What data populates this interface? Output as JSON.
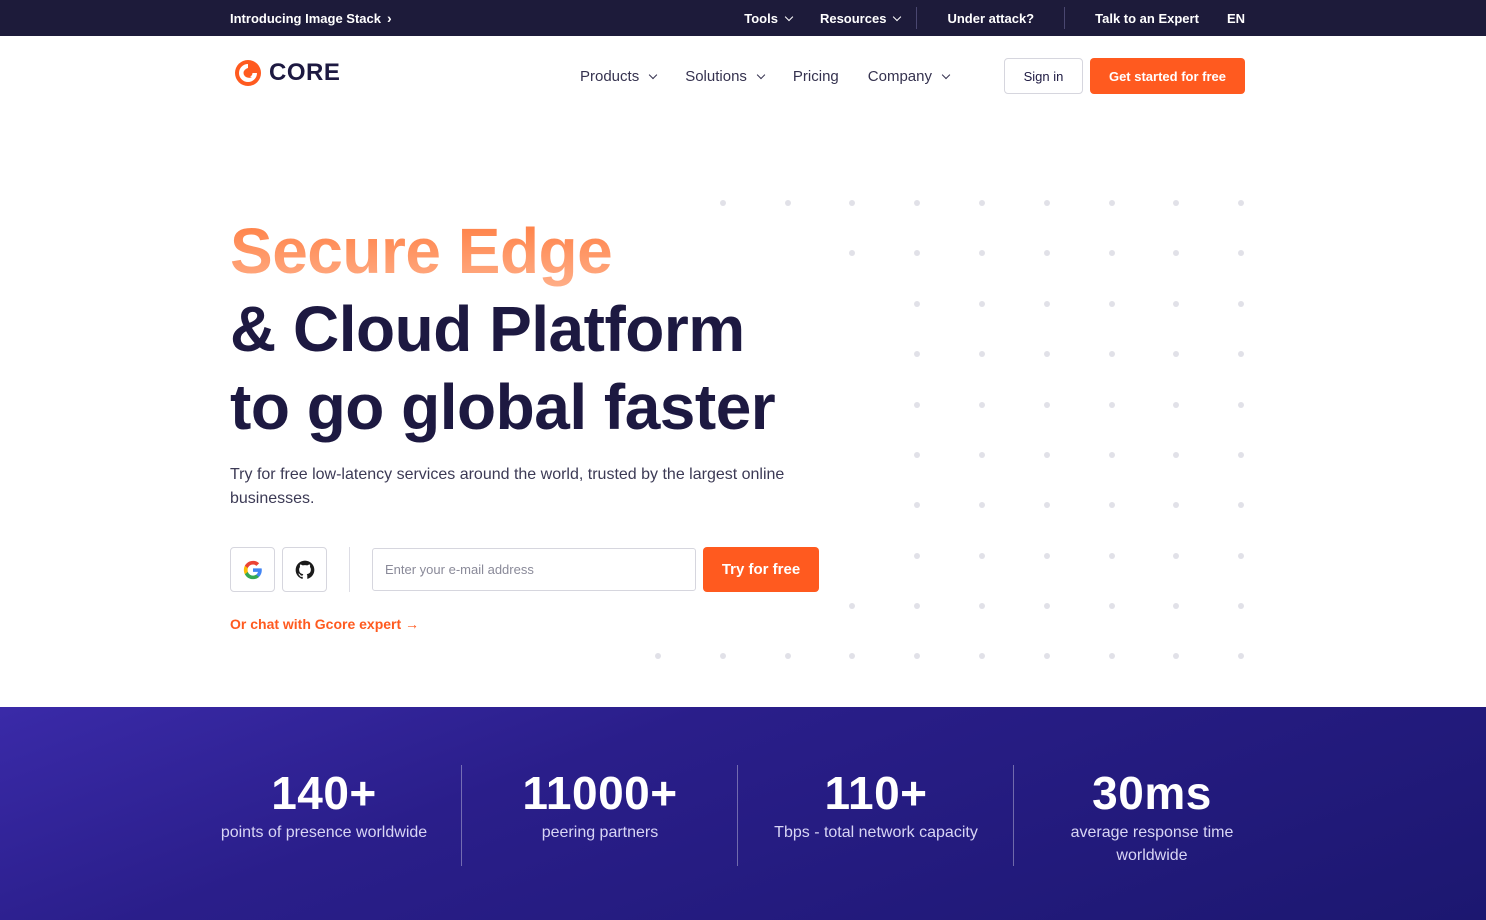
{
  "topbar": {
    "intro": "Introducing Image Stack",
    "tools": "Tools",
    "resources": "Resources",
    "under_attack": "Under attack?",
    "talk": "Talk to an Expert",
    "lang": "EN"
  },
  "header": {
    "logo_text": "CORE",
    "nav": [
      "Products",
      "Solutions",
      "Pricing",
      "Company"
    ],
    "signin": "Sign in",
    "get_started": "Get started for free"
  },
  "hero": {
    "title_line1": "Secure Edge",
    "title_line2": "& Cloud Platform",
    "title_line3": "to go global faster",
    "subtitle": "Try for free low-latency services around the world, trusted by the largest online businesses.",
    "email_placeholder": "Enter your e-mail address",
    "try_button": "Try for free",
    "chat_link": "Or chat with Gcore expert →"
  },
  "stats": [
    {
      "value": "140+",
      "label": "points of presence worldwide"
    },
    {
      "value": "11000+",
      "label": "peering partners"
    },
    {
      "value": "110+",
      "label": "Tbps - total network capacity"
    },
    {
      "value": "30ms",
      "label": "average response time worldwide"
    }
  ],
  "colors": {
    "accent": "#ff5a1f",
    "navy": "#1d1941",
    "topbar": "#1d1b3a",
    "stats_bg": "#2a1e8a"
  },
  "icons": [
    "chevron-right-icon",
    "chevron-down-icon",
    "gcore-logo-icon",
    "google-icon",
    "github-icon",
    "arrow-right-icon"
  ]
}
